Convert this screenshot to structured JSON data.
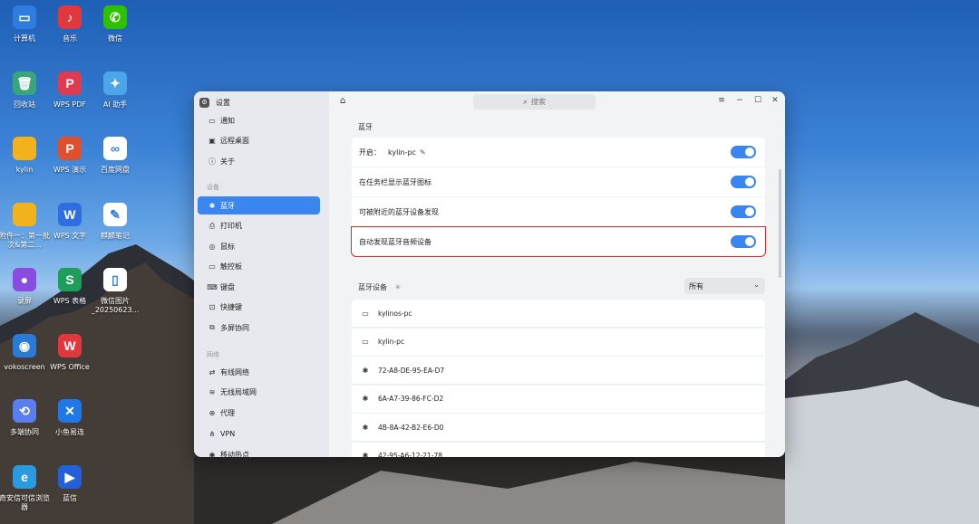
{
  "desktop": {
    "icons": [
      {
        "label": "计算机",
        "icon": "computer-icon",
        "color": "#2f7de0"
      },
      {
        "label": "音乐",
        "icon": "music-icon",
        "color": "#e0383e"
      },
      {
        "label": "微信",
        "icon": "wechat-icon",
        "color": "#2dc100"
      },
      {
        "label": "回收站",
        "icon": "trash-icon",
        "color": "#3aa57a"
      },
      {
        "label": "WPS PDF",
        "icon": "wps-pdf-icon",
        "color": "#e03a4f"
      },
      {
        "label": "AI 助手",
        "icon": "ai-assistant-icon",
        "color": "#4aa6e8"
      },
      {
        "label": "kylin",
        "icon": "folder-icon",
        "color": "#f2b21b"
      },
      {
        "label": "WPS 演示",
        "icon": "wps-presentation-icon",
        "color": "#e0502f"
      },
      {
        "label": "百度网盘",
        "icon": "baidu-netdisk-icon",
        "color": "#ffffff"
      },
      {
        "label": "附件一：第一批次&第二...",
        "icon": "folder-icon",
        "color": "#f2b21b"
      },
      {
        "label": "WPS 文字",
        "icon": "wps-writer-icon",
        "color": "#2f6ee0"
      },
      {
        "label": "麒麟笔记",
        "icon": "notes-icon",
        "color": "#ffffff"
      },
      {
        "label": "录屏",
        "icon": "screen-record-icon",
        "color": "#8a4be0"
      },
      {
        "label": "WPS 表格",
        "icon": "wps-sheet-icon",
        "color": "#1e9e5a"
      },
      {
        "label": "微信图片_20250623...",
        "icon": "image-file-icon",
        "color": "#ffffff"
      },
      {
        "label": "vokoscreen",
        "icon": "vokoscreen-icon",
        "color": "#2a7bd6"
      },
      {
        "label": "WPS Office",
        "icon": "wps-office-icon",
        "color": "#e0383e"
      },
      {
        "label": "多端协同",
        "icon": "multi-device-icon",
        "color": "#5a7ef0"
      },
      {
        "label": "小鱼易连",
        "icon": "xiaoyu-icon",
        "color": "#1f78e6"
      },
      {
        "label": "奇安信可信浏览器",
        "icon": "browser-icon",
        "color": "#2a9ae0"
      },
      {
        "label": "蓝信",
        "icon": "lanxin-icon",
        "color": "#2360d8"
      }
    ]
  },
  "window": {
    "app_title": "设置",
    "search_placeholder": "搜索",
    "sidebar": {
      "items_top": [
        {
          "label": "通知",
          "icon": "notification-icon"
        },
        {
          "label": "远程桌面",
          "icon": "remote-desktop-icon"
        },
        {
          "label": "关于",
          "icon": "info-icon"
        }
      ],
      "cat_devices": "设备",
      "items_devices": [
        {
          "label": "蓝牙",
          "icon": "bluetooth-icon",
          "active": true
        },
        {
          "label": "打印机",
          "icon": "printer-icon"
        },
        {
          "label": "鼠标",
          "icon": "mouse-icon"
        },
        {
          "label": "触控板",
          "icon": "touchpad-icon"
        },
        {
          "label": "键盘",
          "icon": "keyboard-icon"
        },
        {
          "label": "快捷键",
          "icon": "shortcut-icon"
        },
        {
          "label": "多屏协同",
          "icon": "multiscreen-icon"
        }
      ],
      "cat_network": "网络",
      "items_network": [
        {
          "label": "有线网络",
          "icon": "wired-network-icon"
        },
        {
          "label": "无线局域网",
          "icon": "wifi-icon"
        },
        {
          "label": "代理",
          "icon": "proxy-icon"
        },
        {
          "label": "VPN",
          "icon": "vpn-icon"
        },
        {
          "label": "移动热点",
          "icon": "hotspot-icon"
        }
      ]
    },
    "bluetooth": {
      "section_title": "蓝牙",
      "enable_label": "开启：",
      "device_name": "kylin-pc",
      "rows": [
        {
          "label": "在任务栏显示蓝牙图标",
          "on": true
        },
        {
          "label": "可被附近的蓝牙设备发现",
          "on": true
        },
        {
          "label": "自动发现蓝牙音频设备",
          "on": true,
          "highlighted": true
        }
      ],
      "enable_on": true,
      "devices_title": "蓝牙设备",
      "filter_value": "所有",
      "devices": [
        {
          "name": "kylinos-pc",
          "icon": "monitor-icon"
        },
        {
          "name": "kylin-pc",
          "icon": "monitor-icon"
        },
        {
          "name": "72-A8-DE-95-EA-D7",
          "icon": "bluetooth-icon"
        },
        {
          "name": "6A-A7-39-86-FC-D2",
          "icon": "bluetooth-icon"
        },
        {
          "name": "4B-8A-42-B2-E6-D0",
          "icon": "bluetooth-icon"
        },
        {
          "name": "42-95-A6-12-21-78",
          "icon": "bluetooth-icon"
        }
      ]
    }
  }
}
